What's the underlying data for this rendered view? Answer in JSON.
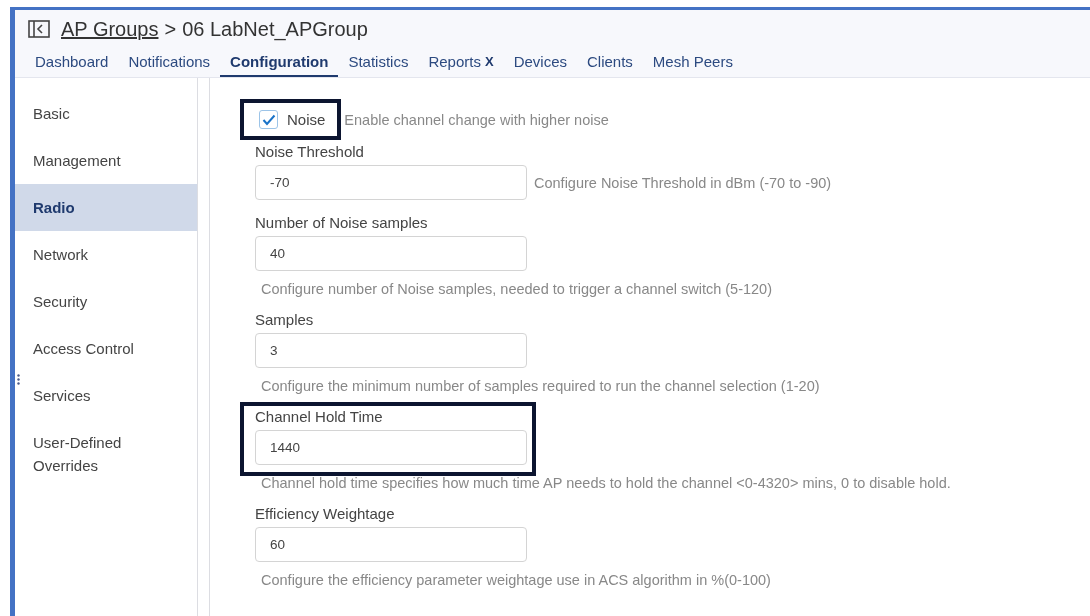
{
  "header": {
    "breadcrumb_link": "AP Groups",
    "breadcrumb_separator": ">",
    "breadcrumb_current": "06 LabNet_APGroup"
  },
  "tabs": [
    {
      "label": "Dashboard",
      "selected": false
    },
    {
      "label": "Notifications",
      "selected": false
    },
    {
      "label": "Configuration",
      "selected": true
    },
    {
      "label": "Statistics",
      "selected": false
    },
    {
      "label": "Reports",
      "badge": "X",
      "selected": false
    },
    {
      "label": "Devices",
      "selected": false
    },
    {
      "label": "Clients",
      "selected": false
    },
    {
      "label": "Mesh Peers",
      "selected": false
    }
  ],
  "sidebar": {
    "items": [
      {
        "label": "Basic",
        "selected": false
      },
      {
        "label": "Management",
        "selected": false
      },
      {
        "label": "Radio",
        "selected": true
      },
      {
        "label": "Network",
        "selected": false
      },
      {
        "label": "Security",
        "selected": false
      },
      {
        "label": "Access Control",
        "selected": false
      },
      {
        "label": "Services",
        "selected": false
      },
      {
        "label": "User-Defined Overrides",
        "selected": false
      }
    ]
  },
  "fields": [
    {
      "kind": "checkbox",
      "label": "Noise",
      "checked": true,
      "help": "Enable channel change with higher noise",
      "highlighted": true
    },
    {
      "kind": "input",
      "label": "Noise Threshold",
      "value": "-70",
      "help": "Configure Noise Threshold in dBm (-70 to -90)",
      "help_inline": true,
      "highlighted": false
    },
    {
      "kind": "input",
      "label": "Number of Noise samples",
      "value": "40",
      "help": "Configure number of Noise samples, needed to trigger a channel switch (5-120)",
      "help_inline": false,
      "highlighted": false
    },
    {
      "kind": "input",
      "label": "Samples",
      "value": "3",
      "help": "Configure the minimum number of samples required to run the channel selection (1-20)",
      "help_inline": false,
      "highlighted": false
    },
    {
      "kind": "input",
      "label": "Channel Hold Time",
      "value": "1440",
      "help": "Channel hold time specifies how much time AP needs to hold the channel <0-4320> mins, 0 to disable hold.",
      "help_inline": false,
      "highlighted": true
    },
    {
      "kind": "input",
      "label": "Efficiency Weightage",
      "value": "60",
      "help": "Configure the efficiency parameter weightage use in ACS algorithm in %(0-100)",
      "help_inline": false,
      "highlighted": false
    }
  ]
}
